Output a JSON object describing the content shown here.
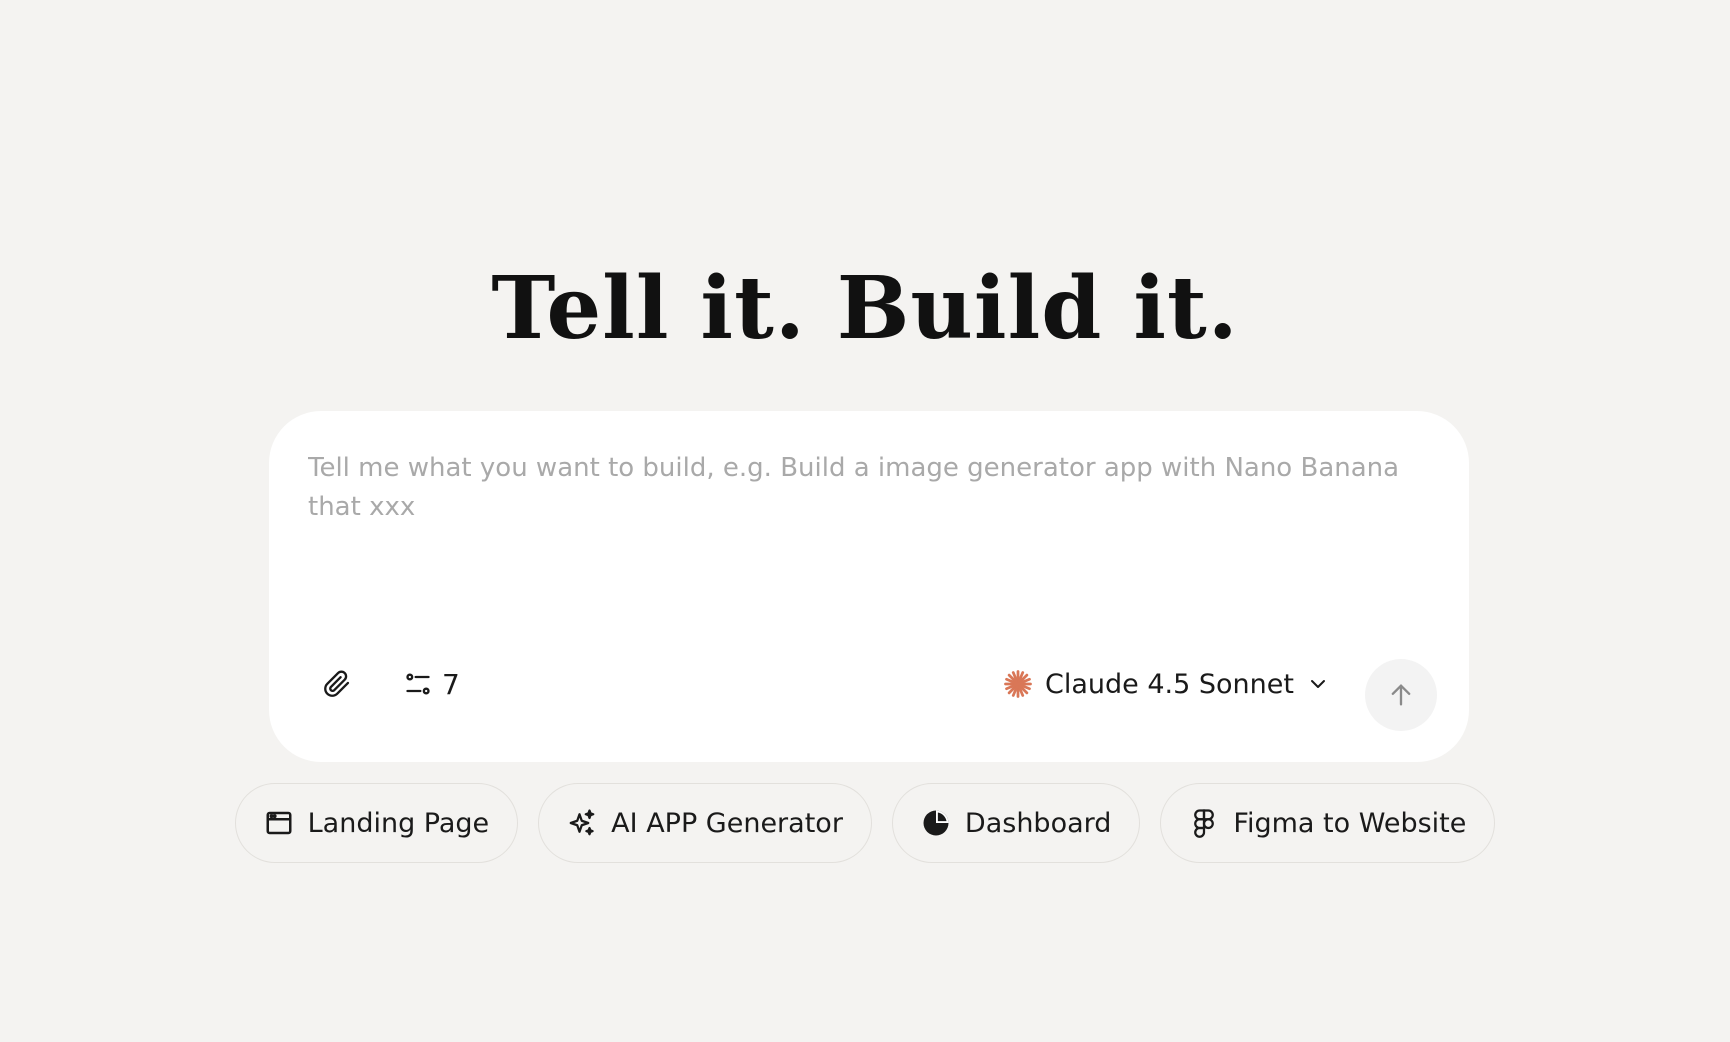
{
  "headline": "Tell it. Build it.",
  "composer": {
    "placeholder": "Tell me what you want to build, e.g. Build a image generator app with Nano Banana that xxx",
    "value": "",
    "attach_icon": "paperclip-icon",
    "settings_icon": "sliders-icon",
    "settings_count": "7",
    "model": {
      "label": "Claude 4.5 Sonnet",
      "icon": "claude-asterisk-icon",
      "icon_color": "#d97757",
      "caret_icon": "chevron-down-icon"
    },
    "send_icon": "arrow-up-icon"
  },
  "suggestions": [
    {
      "label": "Landing Page",
      "icon": "browser-window-icon"
    },
    {
      "label": "AI APP Generator",
      "icon": "sparkles-icon"
    },
    {
      "label": "Dashboard",
      "icon": "pie-chart-icon"
    },
    {
      "label": "Figma to Website",
      "icon": "figma-icon"
    }
  ],
  "colors": {
    "page_background": "#f4f3f1",
    "card_background": "#ffffff",
    "placeholder_text": "#a9a9a9",
    "send_button_background": "#f3f3f3",
    "chip_border": "#e2e0dc"
  }
}
